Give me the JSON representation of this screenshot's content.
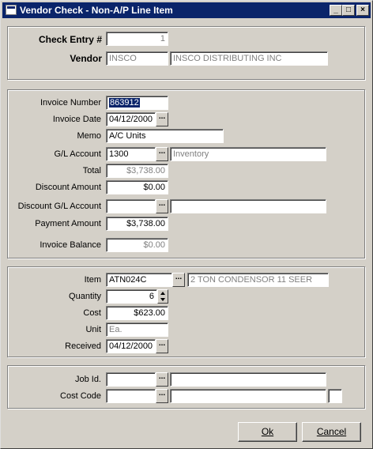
{
  "window": {
    "title": "Vendor Check - Non-A/P Line Item",
    "min_glyph": "_",
    "max_glyph": "□",
    "close_glyph": "×"
  },
  "header": {
    "check_entry_label": "Check Entry #",
    "check_entry_value": "1",
    "vendor_label": "Vendor",
    "vendor_code": "INSCO",
    "vendor_name": "INSCO DISTRIBUTING INC"
  },
  "invoice": {
    "invoice_number_label": "Invoice Number",
    "invoice_number_value": "863912",
    "invoice_date_label": "Invoice Date",
    "invoice_date_value": "04/12/2000",
    "memo_label": "Memo",
    "memo_value": "A/C Units",
    "gl_account_label": "G/L  Account",
    "gl_account_value": "1300",
    "gl_account_desc": "Inventory",
    "total_label": "Total",
    "total_value": "$3,738.00",
    "discount_amount_label": "Discount Amount",
    "discount_amount_value": "$0.00",
    "discount_gl_label": "Discount G/L  Account",
    "discount_gl_value": "",
    "discount_gl_desc": "",
    "payment_amount_label": "Payment Amount",
    "payment_amount_value": "$3,738.00",
    "invoice_balance_label": "Invoice Balance",
    "invoice_balance_value": "$0.00"
  },
  "item": {
    "item_label": "Item",
    "item_value": "ATN024C",
    "item_desc": "2 TON CONDENSOR 11 SEER",
    "quantity_label": "Quantity",
    "quantity_value": "6",
    "cost_label": "Cost",
    "cost_value": "$623.00",
    "unit_label": "Unit",
    "unit_value": "Ea.",
    "received_label": "Received",
    "received_value": "04/12/2000"
  },
  "job": {
    "job_id_label": "Job Id.",
    "job_id_value": "",
    "job_id_desc": "",
    "cost_code_label": "Cost Code",
    "cost_code_value": "",
    "cost_code_desc": "",
    "cost_code_extra": ""
  },
  "buttons": {
    "ok": "Ok",
    "cancel": "Cancel"
  },
  "icons": {
    "ellipsis": "..."
  },
  "colors": {
    "titlebar": "#0a246a",
    "face": "#d4d0c8",
    "disabled_text": "#808080"
  }
}
